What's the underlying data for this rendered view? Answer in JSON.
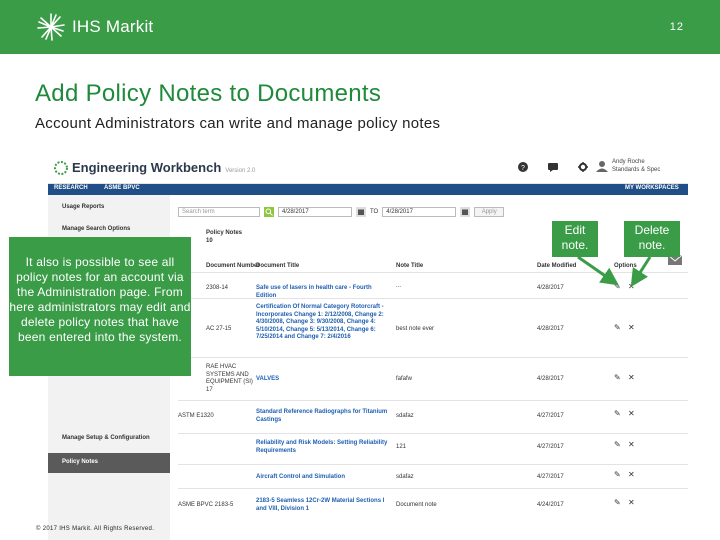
{
  "slide": {
    "brand": "IHS Markit",
    "number": "12",
    "title": "Add Policy Notes to Documents",
    "subtitle": "Account Administrators can write and manage policy notes",
    "copyright": "© 2017 IHS Markit. All Rights Reserved.",
    "colors": {
      "green": "#3b9c48",
      "title_green": "#1e8a3a",
      "nav_blue": "#1f4f86"
    }
  },
  "app": {
    "name": "Engineering Workbench",
    "version": "Version 2.0",
    "user_name": "Andy Roche",
    "user_sub": "Standards & Spec",
    "header_icons": [
      "help-icon",
      "chat-icon",
      "gear-icon"
    ],
    "nav": {
      "research": "RESEARCH",
      "asme": "ASME BPVC",
      "workspaces": "MY WORKSPACES"
    },
    "sidebar": {
      "usage_reports": "Usage Reports",
      "manage_search": "Manage Search Options",
      "manage_setup": "Manage Setup & Configuration",
      "policy_notes": "Policy Notes"
    },
    "search": {
      "placeholder": "Search term",
      "from_date": "4/28/2017",
      "to_label": "TO",
      "to_date": "4/28/2017",
      "apply": "Apply"
    },
    "policy_notes_title": "Policy Notes",
    "policy_notes_count": "10",
    "table": {
      "headers": [
        "Document Number",
        "Document Title",
        "Note Title",
        "Date Modified",
        "Options"
      ],
      "rows": [
        {
          "number": "2308-14",
          "title": "Safe use of lasers in health care - Fourth Edition",
          "note": "...",
          "date": "4/28/2017"
        },
        {
          "number": "AC 27-15",
          "title": "Certification Of Normal Category Rotorcraft - Incorporates Change 1: 2/12/2008, Change 2: 4/30/2008, Change 3: 9/30/2008, Change 4: 5/10/2014, Change 5: 5/13/2014, Change 6: 7/25/2014 and Change 7: 2/4/2016",
          "note": "best note ever",
          "date": "4/28/2017"
        },
        {
          "number": "RAE HVAC SYSTEMS AND EQUIPMENT (SI) 17",
          "title": "VALVES",
          "note": "fafafw",
          "date": "4/28/2017"
        },
        {
          "number": "ASTM E1320",
          "title": "Standard Reference Radiographs for Titanium Castings",
          "note": "sdafaz",
          "date": "4/27/2017"
        },
        {
          "number": "",
          "title": "Reliability and Risk Models: Setting Reliability Requirements",
          "note": "121",
          "date": "4/27/2017"
        },
        {
          "number": "",
          "title": "Aircraft Control and Simulation",
          "note": "sdafaz",
          "date": "4/27/2017"
        },
        {
          "number": "ASME BPVC 2183-5",
          "title": "2183-5 Seamless 12Cr-2W Material Sections I and VIII, Division 1",
          "note": "Document note",
          "date": "4/24/2017"
        }
      ]
    }
  },
  "callouts": {
    "left": "It also is possible to see all policy notes for an account via the Administration page. From here administrators may edit and delete policy notes that have been entered into the system.",
    "edit": "Edit note.",
    "delete": "Delete note."
  }
}
